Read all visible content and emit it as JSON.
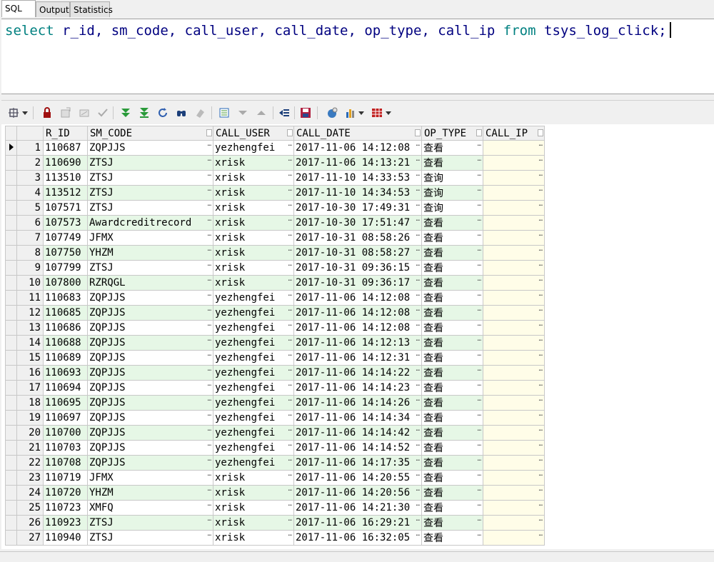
{
  "tabs": [
    {
      "label": "SQL",
      "active": true
    },
    {
      "label": "Output",
      "active": false
    },
    {
      "label": "Statistics",
      "active": false
    }
  ],
  "editor": {
    "kw_select": "select",
    "columns_text": " r_id, sm_code, call_user, call_date, op_type, call_ip ",
    "kw_from": "from",
    "table_text": " tsys_log_click;"
  },
  "toolbar": {
    "icons": [
      "grid-settings-icon",
      "dropdown-arrow-icon",
      "lock-icon",
      "insert-record-icon",
      "delete-record-icon",
      "post-changes-icon",
      "fetch-next-icon",
      "fetch-last-icon",
      "refresh-icon",
      "find-icon",
      "clear-icon",
      "query-by-example-icon",
      "filter-icon",
      "sort-up-icon",
      "export-icon",
      "save-icon",
      "link-icon",
      "chart-icon",
      "chart-dropdown-icon",
      "table-view-icon",
      "table-dropdown-icon"
    ]
  },
  "grid": {
    "columns": [
      "R_ID",
      "SM_CODE",
      "CALL_USER",
      "CALL_DATE",
      "OP_TYPE",
      "CALL_IP"
    ],
    "rows": [
      [
        "1",
        "110687",
        "ZQPJJS",
        "yezhengfei",
        "2017-11-06 14:12:08",
        "查看",
        ""
      ],
      [
        "2",
        "110690",
        "ZTSJ",
        "xrisk",
        "2017-11-06 14:13:21",
        "查看",
        ""
      ],
      [
        "3",
        "113510",
        "ZTSJ",
        "xrisk",
        "2017-11-10 14:33:53",
        "查询",
        ""
      ],
      [
        "4",
        "113512",
        "ZTSJ",
        "xrisk",
        "2017-11-10 14:34:53",
        "查询",
        ""
      ],
      [
        "5",
        "107571",
        "ZTSJ",
        "xrisk",
        "2017-10-30 17:49:31",
        "查询",
        ""
      ],
      [
        "6",
        "107573",
        "Awardcreditrecord",
        "xrisk",
        "2017-10-30 17:51:47",
        "查看",
        ""
      ],
      [
        "7",
        "107749",
        "JFMX",
        "xrisk",
        "2017-10-31 08:58:26",
        "查看",
        ""
      ],
      [
        "8",
        "107750",
        "YHZM",
        "xrisk",
        "2017-10-31 08:58:27",
        "查看",
        ""
      ],
      [
        "9",
        "107799",
        "ZTSJ",
        "xrisk",
        "2017-10-31 09:36:15",
        "查看",
        ""
      ],
      [
        "10",
        "107800",
        "RZRQGL",
        "xrisk",
        "2017-10-31 09:36:17",
        "查看",
        ""
      ],
      [
        "11",
        "110683",
        "ZQPJJS",
        "yezhengfei",
        "2017-11-06 14:12:08",
        "查看",
        ""
      ],
      [
        "12",
        "110685",
        "ZQPJJS",
        "yezhengfei",
        "2017-11-06 14:12:08",
        "查看",
        ""
      ],
      [
        "13",
        "110686",
        "ZQPJJS",
        "yezhengfei",
        "2017-11-06 14:12:08",
        "查看",
        ""
      ],
      [
        "14",
        "110688",
        "ZQPJJS",
        "yezhengfei",
        "2017-11-06 14:12:13",
        "查看",
        ""
      ],
      [
        "15",
        "110689",
        "ZQPJJS",
        "yezhengfei",
        "2017-11-06 14:12:31",
        "查看",
        ""
      ],
      [
        "16",
        "110693",
        "ZQPJJS",
        "yezhengfei",
        "2017-11-06 14:14:22",
        "查看",
        ""
      ],
      [
        "17",
        "110694",
        "ZQPJJS",
        "yezhengfei",
        "2017-11-06 14:14:23",
        "查看",
        ""
      ],
      [
        "18",
        "110695",
        "ZQPJJS",
        "yezhengfei",
        "2017-11-06 14:14:26",
        "查看",
        ""
      ],
      [
        "19",
        "110697",
        "ZQPJJS",
        "yezhengfei",
        "2017-11-06 14:14:34",
        "查看",
        ""
      ],
      [
        "20",
        "110700",
        "ZQPJJS",
        "yezhengfei",
        "2017-11-06 14:14:42",
        "查看",
        ""
      ],
      [
        "21",
        "110703",
        "ZQPJJS",
        "yezhengfei",
        "2017-11-06 14:14:52",
        "查看",
        ""
      ],
      [
        "22",
        "110708",
        "ZQPJJS",
        "yezhengfei",
        "2017-11-06 14:17:35",
        "查看",
        ""
      ],
      [
        "23",
        "110719",
        "JFMX",
        "xrisk",
        "2017-11-06 14:20:55",
        "查看",
        ""
      ],
      [
        "24",
        "110720",
        "YHZM",
        "xrisk",
        "2017-11-06 14:20:56",
        "查看",
        ""
      ],
      [
        "25",
        "110723",
        "XMFQ",
        "xrisk",
        "2017-11-06 14:21:30",
        "查看",
        ""
      ],
      [
        "26",
        "110923",
        "ZTSJ",
        "xrisk",
        "2017-11-06 16:29:21",
        "查看",
        ""
      ],
      [
        "27",
        "110940",
        "ZTSJ",
        "xrisk",
        "2017-11-06 16:32:05",
        "查看",
        ""
      ]
    ]
  },
  "colors": {
    "even_row": "#e6f7e6",
    "ip_cell": "#fffde8",
    "sql_identifier": "#000080",
    "sql_keyword": "#008080"
  }
}
